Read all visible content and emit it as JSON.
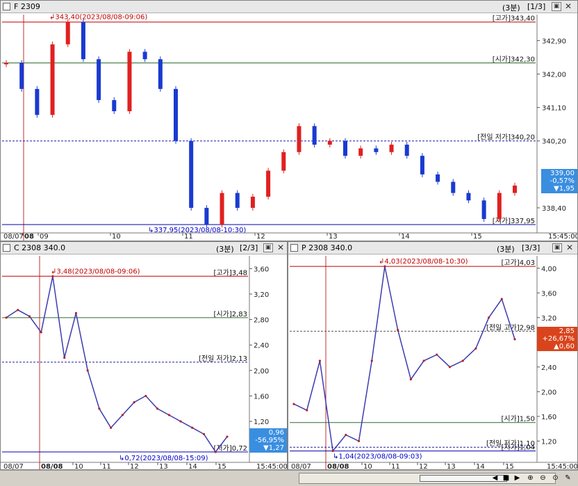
{
  "panels": [
    {
      "id": "p1",
      "title": "F 2309",
      "period": "(3분)",
      "index": "[1/3]",
      "check_icon": "checkbox-icon",
      "restore_icon": "restore-icon",
      "close_icon": "close-icon",
      "y_ticks": [
        "342,90",
        "342,00",
        "341,10",
        "340,20",
        "338,40"
      ],
      "x_ticks": [
        "08/07",
        "08",
        "09",
        "10",
        "11",
        "12",
        "13",
        "14",
        "15",
        "15:45:00"
      ],
      "levels": [
        {
          "name": "high",
          "label": "[고가]343,40",
          "value": 343.4,
          "color": "#c00000",
          "style": "solid"
        },
        {
          "name": "open",
          "label": "[시가]342,30",
          "value": 342.3,
          "color": "#2e6b2e",
          "style": "solid"
        },
        {
          "name": "prevlow",
          "label": "[전일 저가]340,20",
          "value": 340.2,
          "color": "#1c1ca0",
          "style": "dash"
        },
        {
          "name": "low",
          "label": "[저가]337,95",
          "value": 337.95,
          "color": "#0000aa",
          "style": "solid"
        }
      ],
      "annotations": [
        {
          "name": "high-annotation",
          "text": "343,40(2023/08/08-09:06)",
          "color": "#c00000"
        },
        {
          "name": "low-annotation",
          "text": "337,95(2023/08/08-10:30)",
          "color": "#0000cc"
        }
      ],
      "price_box": {
        "price": "339,00",
        "change_pct": "-0,57%",
        "change": "▼1,95",
        "color": "#3a8ee0"
      }
    },
    {
      "id": "p2",
      "title": "C 2308 340.0",
      "period": "(3분)",
      "index": "[2/3]",
      "check_icon": "checkbox-icon",
      "restore_icon": "restore-icon",
      "close_icon": "close-icon",
      "corner_icon": "panel-menu-icon",
      "y_ticks": [
        "3,60",
        "3,20",
        "2,80",
        "2,40",
        "2,00",
        "1,60",
        "1,20"
      ],
      "x_ticks": [
        "08/07",
        "08/08",
        "10",
        "11",
        "12",
        "13",
        "14",
        "15",
        "15:45:00"
      ],
      "levels": [
        {
          "name": "high",
          "label": "[고가]3,48",
          "value": 3.48,
          "color": "#c00000",
          "style": "solid"
        },
        {
          "name": "open",
          "label": "[시가]2,83",
          "value": 2.83,
          "color": "#2e6b2e",
          "style": "solid"
        },
        {
          "name": "prevlow",
          "label": "[전일 저가]2,13",
          "value": 2.13,
          "color": "#1c1ca0",
          "style": "dash"
        },
        {
          "name": "low",
          "label": "[저가]0,72",
          "value": 0.72,
          "color": "#0000aa",
          "style": "solid"
        }
      ],
      "annotations": [
        {
          "name": "high-annotation",
          "text": "3,48(2023/08/08-09:06)",
          "color": "#c00000"
        },
        {
          "name": "low-annotation",
          "text": "0,72(2023/08/08-15:09)",
          "color": "#0000cc"
        }
      ],
      "price_box": {
        "price": "0,96",
        "change_pct": "-56,95%",
        "change": "▼1,27",
        "color": "#3a8ee0"
      }
    },
    {
      "id": "p3",
      "title": "P 2308 340.0",
      "period": "(3분)",
      "index": "[3/3]",
      "check_icon": "checkbox-icon",
      "restore_icon": "restore-icon",
      "close_icon": "close-icon",
      "corner_icon": "panel-menu-icon",
      "y_ticks": [
        "4,00",
        "3,60",
        "3,20",
        "2,80",
        "2,40",
        "2,00",
        "1,60",
        "1,20"
      ],
      "x_ticks": [
        "08/07",
        "08/08",
        "10",
        "11",
        "12",
        "13",
        "14",
        "15",
        "15:45:00"
      ],
      "levels": [
        {
          "name": "high",
          "label": "[고가]4,03",
          "value": 4.03,
          "color": "#c00000",
          "style": "solid"
        },
        {
          "name": "prevhigh",
          "label": "[전일 고가]2,98",
          "value": 2.98,
          "color": "#555555",
          "style": "dash"
        },
        {
          "name": "open",
          "label": "[시가]1,50",
          "value": 1.5,
          "color": "#2e6b2e",
          "style": "solid"
        },
        {
          "name": "prevlow",
          "label": "[전일 저가]1,10",
          "value": 1.1,
          "color": "#1c1ca0",
          "style": "dash"
        },
        {
          "name": "low",
          "label": "[저가]1,04",
          "value": 1.04,
          "color": "#0000aa",
          "style": "solid"
        }
      ],
      "annotations": [
        {
          "name": "high-annotation",
          "text": "4,03(2023/08/08-10:30)",
          "color": "#c00000"
        },
        {
          "name": "low-annotation",
          "text": "1,04(2023/08/08-09:03)",
          "color": "#0000cc"
        }
      ],
      "price_box": {
        "price": "2,85",
        "change_pct": "+26,67%",
        "change": "▲0,60",
        "color": "#d9441c"
      }
    }
  ],
  "toolbar": {
    "scroll_left_icon": "scroll-left-icon",
    "stop_icon": "stop-icon",
    "scroll_right_icon": "scroll-right-icon",
    "zoom_in_icon": "zoom-in-icon",
    "zoom_out_icon": "zoom-out-icon",
    "zoom_reset_icon": "zoom-reset-icon",
    "tool_icon": "tool-icon"
  },
  "chart_data": [
    {
      "type": "candlestick",
      "title": "F 2309",
      "series": [
        {
          "name": "F 2309",
          "values": [
            342.3,
            341.6,
            340.9,
            342.8,
            343.4,
            342.4,
            341.3,
            341.0,
            342.6,
            342.4,
            341.6,
            340.2,
            338.4,
            337.95,
            338.8,
            338.4,
            338.7,
            339.4,
            339.9,
            340.6,
            340.1,
            340.2,
            339.8,
            340.0,
            339.9,
            340.1,
            339.8,
            339.3,
            339.1,
            338.8,
            338.6,
            338.1,
            338.8,
            339.0
          ]
        }
      ],
      "ylim": [
        337.8,
        343.6
      ]
    },
    {
      "type": "line",
      "title": "C 2308 340.0",
      "series": [
        {
          "name": "C 2308 340.0",
          "values": [
            2.83,
            2.95,
            2.85,
            2.6,
            3.48,
            2.2,
            2.9,
            2.0,
            1.4,
            1.1,
            1.3,
            1.5,
            1.6,
            1.4,
            1.3,
            1.2,
            1.1,
            1.0,
            0.72,
            0.96
          ]
        }
      ],
      "ylim": [
        0.6,
        3.8
      ]
    },
    {
      "type": "line",
      "title": "P 2308 340.0",
      "series": [
        {
          "name": "P 2308 340.0",
          "values": [
            1.8,
            1.7,
            2.5,
            1.04,
            1.3,
            1.2,
            2.5,
            4.03,
            3.0,
            2.2,
            2.5,
            2.6,
            2.4,
            2.5,
            2.7,
            3.2,
            3.5,
            2.85
          ]
        }
      ],
      "ylim": [
        0.9,
        4.2
      ]
    }
  ]
}
